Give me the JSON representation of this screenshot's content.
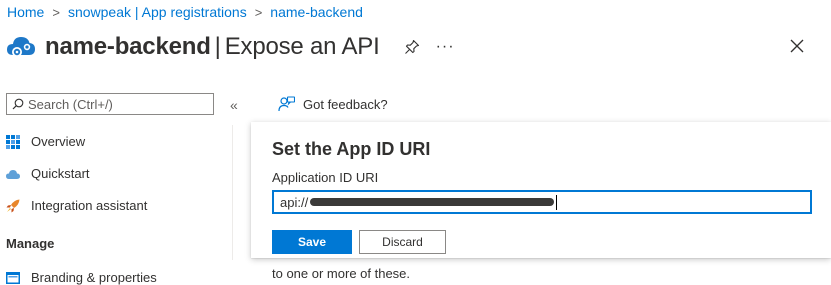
{
  "breadcrumb": [
    {
      "label": "Home"
    },
    {
      "label": "snowpeak | App registrations"
    },
    {
      "label": "name-backend"
    }
  ],
  "header": {
    "app_name": "name-backend",
    "separator": "|",
    "page_title": "Expose an API",
    "more_label": "···"
  },
  "search": {
    "placeholder": "Search (Ctrl+/)"
  },
  "sidebar": {
    "collapse_label": "«",
    "items": [
      {
        "label": "Overview",
        "icon": "overview-grid-icon"
      },
      {
        "label": "Quickstart",
        "icon": "cloud-icon"
      },
      {
        "label": "Integration assistant",
        "icon": "rocket-icon"
      }
    ],
    "section": "Manage",
    "manage_items": [
      {
        "label": "Branding & properties",
        "icon": "branding-icon"
      }
    ]
  },
  "feedback": {
    "label": "Got feedback?"
  },
  "panel": {
    "title": "Set the App ID URI",
    "field_label": "Application ID URI",
    "field_value_prefix": "api://",
    "save_label": "Save",
    "discard_label": "Discard"
  },
  "background_text": "to one or more of these.",
  "colors": {
    "accent": "#0078d4",
    "text": "#323130",
    "border": "#8a8886"
  }
}
